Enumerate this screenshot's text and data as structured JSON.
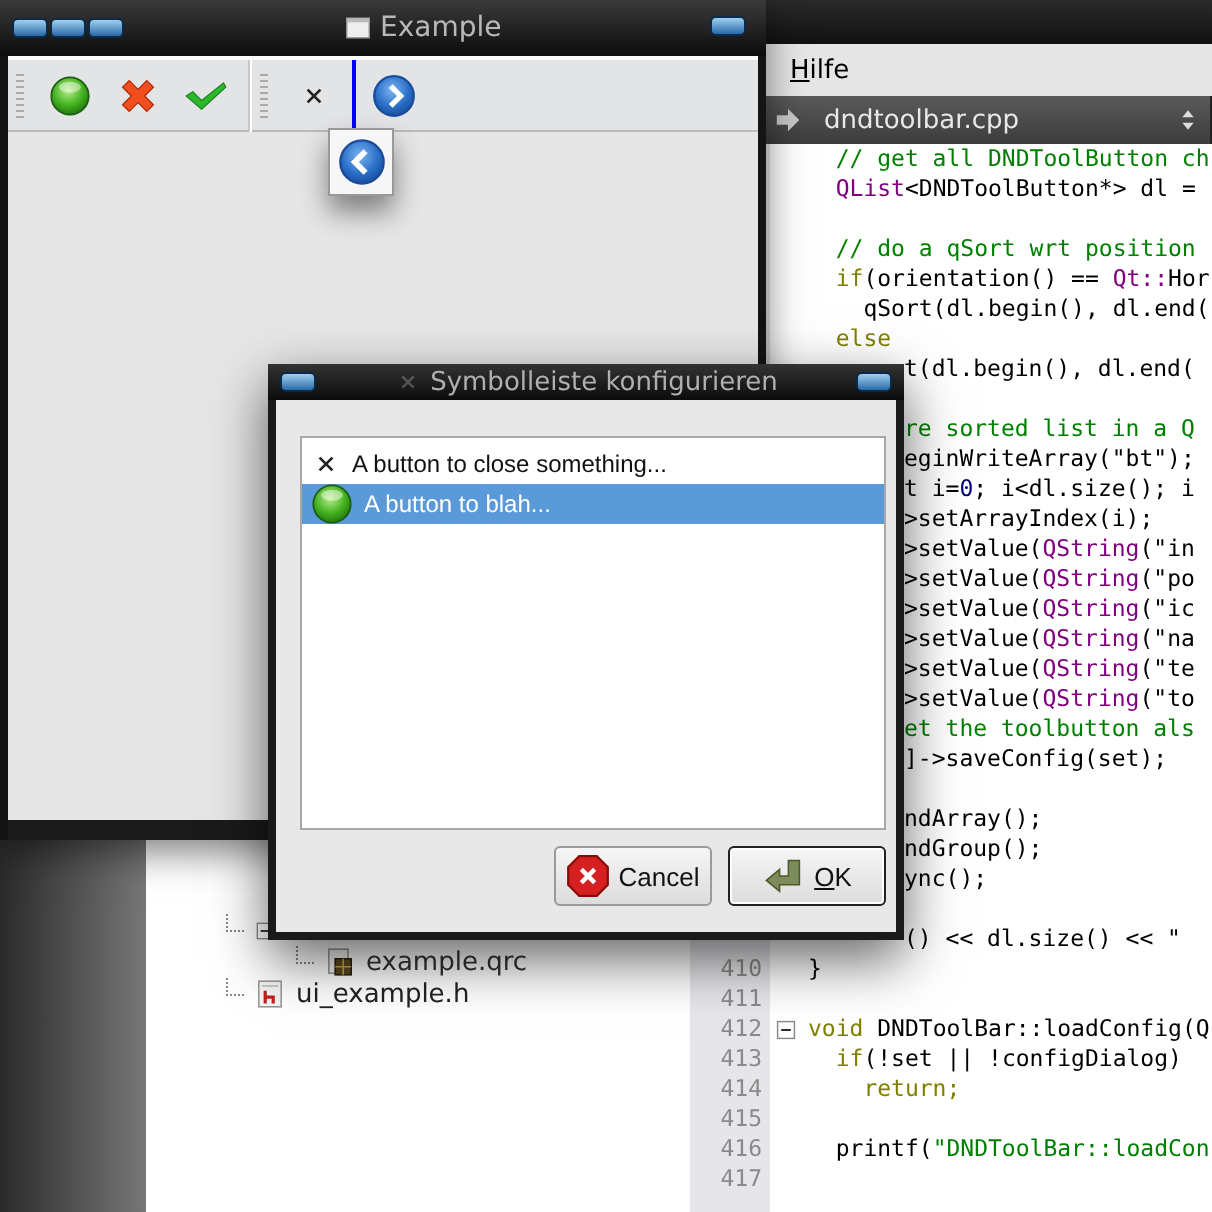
{
  "ide": {
    "menu": [
      {
        "label": "Hilfe"
      }
    ],
    "file_selector": {
      "value": "dndtoolbar.cpp"
    },
    "project_tree": [
      {
        "expanded": true,
        "children": [
          {
            "label": "example.qrc",
            "kind": "resource"
          }
        ]
      },
      {
        "label": "ui_example.h",
        "kind": "header"
      }
    ],
    "code_lines": [
      {
        "kind": "code",
        "segments": [
          {
            "text": "  // get all DNDToolButton ch",
            "kind": "comment"
          }
        ]
      },
      {
        "kind": "code",
        "segments": [
          {
            "text": "  QList",
            "kind": "type"
          },
          {
            "text": "<DNDToolButton*> dl = ",
            "kind": "plain"
          }
        ]
      },
      {
        "kind": "blank"
      },
      {
        "kind": "code",
        "segments": [
          {
            "text": "  // do a qSort wrt position",
            "kind": "comment"
          }
        ]
      },
      {
        "kind": "code",
        "segments": [
          {
            "text": "  if",
            "kind": "keyword"
          },
          {
            "text": "(orientation() == ",
            "kind": "plain"
          },
          {
            "text": "Qt::",
            "kind": "type"
          },
          {
            "text": "Hor",
            "kind": "plain"
          }
        ]
      },
      {
        "kind": "code",
        "segments": [
          {
            "text": "    qSort(dl.begin(), dl.end(",
            "kind": "plain"
          }
        ]
      },
      {
        "kind": "code",
        "segments": [
          {
            "text": "  else",
            "kind": "keyword"
          }
        ]
      },
      {
        "kind": "code",
        "covered": true,
        "segments": [
          {
            "text": "t(dl.begin(), dl.end(",
            "kind": "plain"
          }
        ]
      },
      {
        "kind": "blank"
      },
      {
        "kind": "code",
        "covered": true,
        "segments": [
          {
            "text": "re sorted list in a Q",
            "kind": "comment"
          }
        ]
      },
      {
        "kind": "code",
        "covered": true,
        "segments": [
          {
            "text": "eginWriteArray(\"bt\");",
            "kind": "plain"
          }
        ]
      },
      {
        "kind": "code",
        "covered": true,
        "segments": [
          {
            "text": "t i=",
            "kind": "plain"
          },
          {
            "text": "0",
            "kind": "number"
          },
          {
            "text": "; i<dl.size(); i",
            "kind": "plain"
          }
        ]
      },
      {
        "kind": "code",
        "covered": true,
        "segments": [
          {
            "text": ">setArrayIndex(i);",
            "kind": "plain"
          }
        ]
      },
      {
        "kind": "code",
        "covered": true,
        "segments": [
          {
            "text": ">setValue(",
            "kind": "plain"
          },
          {
            "text": "QString",
            "kind": "type"
          },
          {
            "text": "(\"in",
            "kind": "plain"
          }
        ]
      },
      {
        "kind": "code",
        "covered": true,
        "segments": [
          {
            "text": ">setValue(",
            "kind": "plain"
          },
          {
            "text": "QString",
            "kind": "type"
          },
          {
            "text": "(\"po",
            "kind": "plain"
          }
        ]
      },
      {
        "kind": "code",
        "covered": true,
        "segments": [
          {
            "text": ">setValue(",
            "kind": "plain"
          },
          {
            "text": "QString",
            "kind": "type"
          },
          {
            "text": "(\"ic",
            "kind": "plain"
          }
        ]
      },
      {
        "kind": "code",
        "covered": true,
        "segments": [
          {
            "text": ">setValue(",
            "kind": "plain"
          },
          {
            "text": "QString",
            "kind": "type"
          },
          {
            "text": "(\"na",
            "kind": "plain"
          }
        ]
      },
      {
        "kind": "code",
        "covered": true,
        "segments": [
          {
            "text": ">setValue(",
            "kind": "plain"
          },
          {
            "text": "QString",
            "kind": "type"
          },
          {
            "text": "(\"te",
            "kind": "plain"
          }
        ]
      },
      {
        "kind": "code",
        "covered": true,
        "segments": [
          {
            "text": ">setValue(",
            "kind": "plain"
          },
          {
            "text": "QString",
            "kind": "type"
          },
          {
            "text": "(\"to",
            "kind": "plain"
          }
        ]
      },
      {
        "kind": "code",
        "covered": true,
        "segments": [
          {
            "text": "et the toolbutton als",
            "kind": "comment"
          }
        ]
      },
      {
        "kind": "code",
        "covered": true,
        "segments": [
          {
            "text": "]->saveConfig(set);",
            "kind": "plain"
          }
        ]
      },
      {
        "kind": "blank"
      },
      {
        "kind": "code",
        "covered": true,
        "segments": [
          {
            "text": "ndArray();",
            "kind": "plain"
          }
        ]
      },
      {
        "kind": "code",
        "covered": true,
        "segments": [
          {
            "text": "ndGroup();",
            "kind": "plain"
          }
        ]
      },
      {
        "kind": "code",
        "covered": true,
        "segments": [
          {
            "text": "ync();",
            "kind": "plain"
          }
        ]
      },
      {
        "kind": "blank"
      },
      {
        "kind": "code",
        "covered": true,
        "segments": [
          {
            "text": "() << dl.size() << \"",
            "kind": "plain"
          }
        ]
      },
      {
        "kind": "code",
        "number": "410",
        "segments": [
          {
            "text": "}",
            "kind": "plain"
          }
        ]
      },
      {
        "kind": "blank",
        "number": "411"
      },
      {
        "kind": "code",
        "number": "412",
        "expanded": true,
        "segments": [
          {
            "text": "void",
            "kind": "keyword"
          },
          {
            "text": " DNDToolBar::loadConfig(Q",
            "kind": "plain"
          }
        ]
      },
      {
        "kind": "code",
        "number": "413",
        "segments": [
          {
            "text": "  if",
            "kind": "keyword"
          },
          {
            "text": "(!set || !configDialog)",
            "kind": "plain"
          }
        ]
      },
      {
        "kind": "code",
        "number": "414",
        "segments": [
          {
            "text": "    return;",
            "kind": "keyword"
          }
        ]
      },
      {
        "kind": "blank",
        "number": "415"
      },
      {
        "kind": "code",
        "number": "416",
        "segments": [
          {
            "text": "  printf(",
            "kind": "plain"
          },
          {
            "text": "\"DNDToolBar::loadCon",
            "kind": "string"
          }
        ]
      },
      {
        "kind": "blank",
        "number": "417"
      }
    ]
  },
  "example_window": {
    "title": "Example",
    "toolbars": [
      {
        "buttons": [
          {
            "kind": "ball"
          },
          {
            "kind": "red-cross"
          },
          {
            "kind": "check"
          }
        ]
      },
      {
        "buttons": [
          {
            "kind": "close"
          },
          {
            "kind": "drop-indicator"
          },
          {
            "kind": "forward"
          }
        ]
      }
    ],
    "drag_preview": {
      "kind": "back"
    }
  },
  "dialog": {
    "title": "Symbolleiste konfigurieren",
    "items": [
      {
        "label": "A button to close something...",
        "kind": "close",
        "selected": false
      },
      {
        "label": "A button to blah...",
        "kind": "ball",
        "selected": true
      }
    ],
    "buttons": [
      {
        "label": "Cancel",
        "kind": "cancel",
        "default": false
      },
      {
        "label": "OK",
        "kind": "ok",
        "default": true
      }
    ]
  }
}
